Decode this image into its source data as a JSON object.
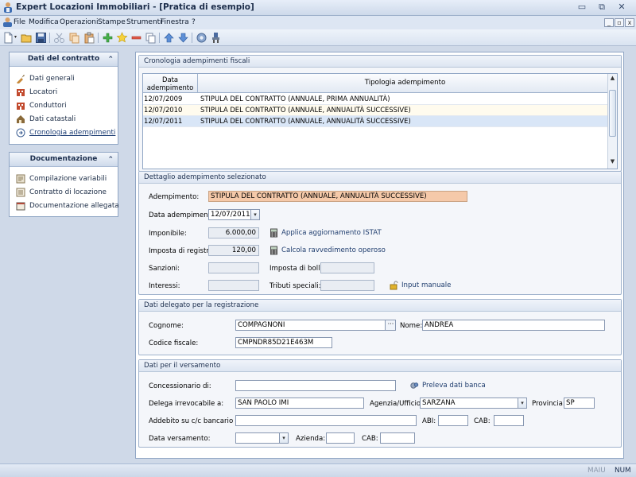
{
  "window": {
    "title": "Expert Locazioni Immobiliari - [Pratica di esempio]",
    "buttons": {
      "minimize": "▭",
      "restore": "⧉",
      "close": "✕"
    }
  },
  "menu": {
    "items": [
      "File",
      "Modifica",
      "Operazioni",
      "Stampe",
      "Strumenti",
      "Finestra",
      "?"
    ],
    "mdi": {
      "minimize": "_",
      "restore": "▫",
      "close": "x"
    }
  },
  "toolbar": {
    "buttons": [
      "new-icon",
      "open-icon",
      "save-icon",
      "cut-icon",
      "copy-icon",
      "paste-icon",
      "add-icon",
      "star-icon",
      "remove-icon",
      "duplicate-icon",
      "move-up-icon",
      "move-down-icon",
      "help-icon",
      "tools-icon"
    ]
  },
  "sidebar": {
    "contratto": {
      "title": "Dati del contratto",
      "items": [
        {
          "label": "Dati generali",
          "icon": "general-data-icon"
        },
        {
          "label": "Locatori",
          "icon": "landlords-icon"
        },
        {
          "label": "Conduttori",
          "icon": "tenants-icon"
        },
        {
          "label": "Dati catastali",
          "icon": "cadastral-icon"
        },
        {
          "label": "Cronologia adempimenti",
          "icon": "history-icon"
        }
      ]
    },
    "documentazione": {
      "title": "Documentazione",
      "items": [
        {
          "label": "Compilazione variabili",
          "icon": "variables-icon"
        },
        {
          "label": "Contratto di locazione",
          "icon": "contract-icon"
        },
        {
          "label": "Documentazione allegata",
          "icon": "attachments-icon"
        }
      ]
    }
  },
  "cronologia": {
    "title": "Cronologia adempimenti fiscali",
    "columns": {
      "date": "Data adempimento",
      "tipo": "Tipologia adempimento"
    },
    "rows": [
      {
        "date": "12/07/2009",
        "tipo": "STIPULA DEL CONTRATTO (ANNUALE, PRIMA ANNUALITÀ)"
      },
      {
        "date": "12/07/2010",
        "tipo": "STIPULA DEL CONTRATTO (ANNUALE, ANNUALITÀ SUCCESSIVE)"
      },
      {
        "date": "12/07/2011",
        "tipo": "STIPULA DEL CONTRATTO (ANNUALE, ANNUALITÀ SUCCESSIVE)"
      }
    ]
  },
  "dettaglio": {
    "title": "Dettaglio adempimento selezionato",
    "adempimento_label": "Adempimento:",
    "adempimento_value": "STIPULA DEL CONTRATTO (ANNUALE, ANNUALITÀ SUCCESSIVE)",
    "data_label": "Data adempimento:",
    "data_value": "12/07/2011",
    "imponibile_label": "Imponibile:",
    "imponibile_value": "6.000,00",
    "imposta_registro_label": "Imposta di registro:",
    "imposta_registro_value": "120,00",
    "sanzioni_label": "Sanzioni:",
    "sanzioni_value": "",
    "interessi_label": "Interessi:",
    "interessi_value": "",
    "imposta_bollo_label": "Imposta di bollo:",
    "imposta_bollo_value": "",
    "tributi_label": "Tributi speciali:",
    "tributi_value": "",
    "istat_link": "Applica aggiornamento ISTAT",
    "ravvedimento_link": "Calcola ravvedimento operoso",
    "input_manuale_link": "Input manuale"
  },
  "delegato": {
    "title": "Dati delegato per la registrazione",
    "cognome_label": "Cognome:",
    "cognome_value": "COMPAGNONI",
    "nome_label": "Nome:",
    "nome_value": "ANDREA",
    "cf_label": "Codice fiscale:",
    "cf_value": "CMPNDR85D21E463M"
  },
  "versamento": {
    "title": "Dati per il versamento",
    "concessionario_label": "Concessionario di:",
    "concessionario_value": "",
    "preleva_link": "Preleva dati banca",
    "delega_label": "Delega irrevocabile a:",
    "delega_value": "SAN PAOLO IMI",
    "agenzia_label": "Agenzia/Ufficio:",
    "agenzia_value": "SARZANA",
    "provincia_label": "Provincia:",
    "provincia_value": "SP",
    "addebito_label": "Addebito su c/c bancario n.:",
    "addebito_value": "",
    "abi_label": "ABI:",
    "abi_value": "",
    "cab_label": "CAB:",
    "cab_value": "",
    "data_versamento_label": "Data versamento:",
    "data_versamento_value": "",
    "azienda_label": "Azienda:",
    "azienda_value": "",
    "cab2_label": "CAB:",
    "cab2_value": ""
  },
  "statusbar": {
    "maiu": "MAIU",
    "num": "NUM"
  }
}
